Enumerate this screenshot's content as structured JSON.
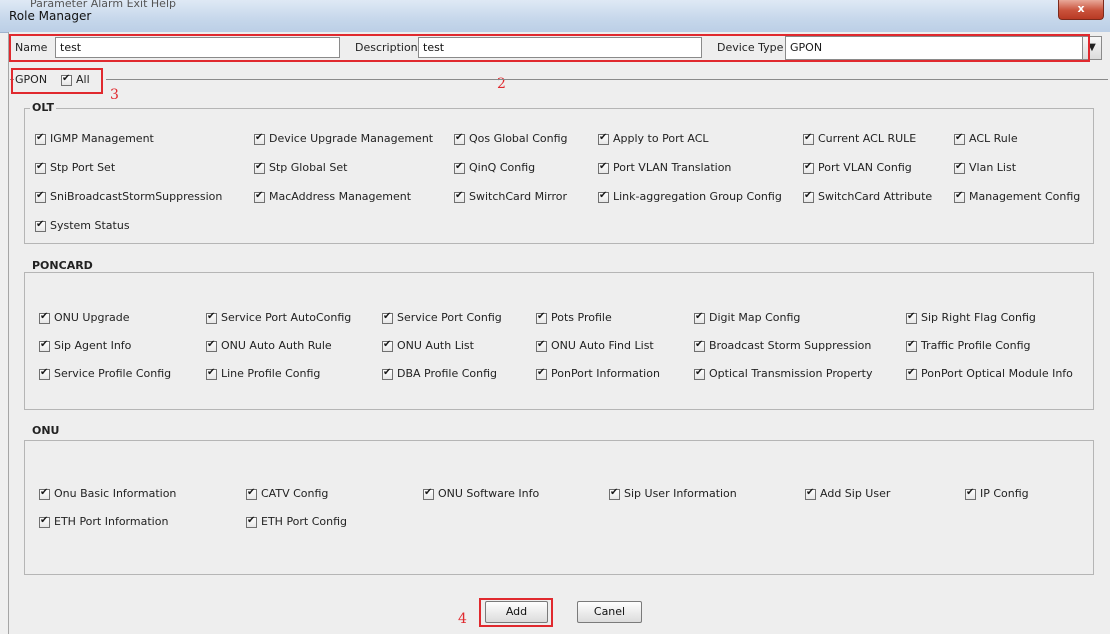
{
  "window": {
    "title": "Role Manager",
    "menu_ghost": "Parameter  Alarm  Exit  Help",
    "close_label": "x"
  },
  "form": {
    "name_label": "Name",
    "name_value": "test",
    "description_label": "Description",
    "description_value": "test",
    "device_type_label": "Device Type",
    "device_type_value": "GPON"
  },
  "gpon": {
    "label": "GPON",
    "all_label": "All"
  },
  "annotations": {
    "a2": "2",
    "a3": "3",
    "a4": "4"
  },
  "sections": {
    "olt": {
      "title": "OLT",
      "items": [
        "IGMP Management",
        "Device Upgrade Management",
        "Qos Global Config",
        "Apply to Port ACL",
        "Current ACL RULE",
        "ACL Rule",
        "Stp Port Set",
        "Stp Global Set",
        "QinQ Config",
        "Port VLAN Translation",
        "Port VLAN Config",
        "Vlan List",
        "SniBroadcastStormSuppression",
        "MacAddress Management",
        "SwitchCard Mirror",
        "Link-aggregation Group Config",
        "SwitchCard Attribute",
        "Management Config",
        "System Status"
      ]
    },
    "poncard": {
      "title": "PONCARD",
      "items": [
        "ONU Upgrade",
        "Service Port AutoConfig",
        "Service Port Config",
        "Pots Profile",
        "Digit Map Config",
        "Sip Right Flag Config",
        "Sip Agent Info",
        "ONU Auto Auth Rule",
        "ONU Auth List",
        "ONU Auto Find List",
        "Broadcast Storm Suppression",
        "Traffic Profile Config",
        "Service Profile Config",
        "Line Profile Config",
        "DBA Profile Config",
        "PonPort Information",
        "Optical Transmission Property",
        "PonPort Optical Module Info"
      ]
    },
    "onu": {
      "title": "ONU",
      "items": [
        "Onu Basic Information",
        "CATV Config",
        "ONU Software Info",
        "Sip User Information",
        "Add Sip User",
        "IP Config",
        "ETH Port Information",
        "ETH Port Config"
      ]
    }
  },
  "buttons": {
    "add": "Add",
    "cancel": "Canel"
  },
  "colors": {
    "highlight": "#e0292e"
  }
}
